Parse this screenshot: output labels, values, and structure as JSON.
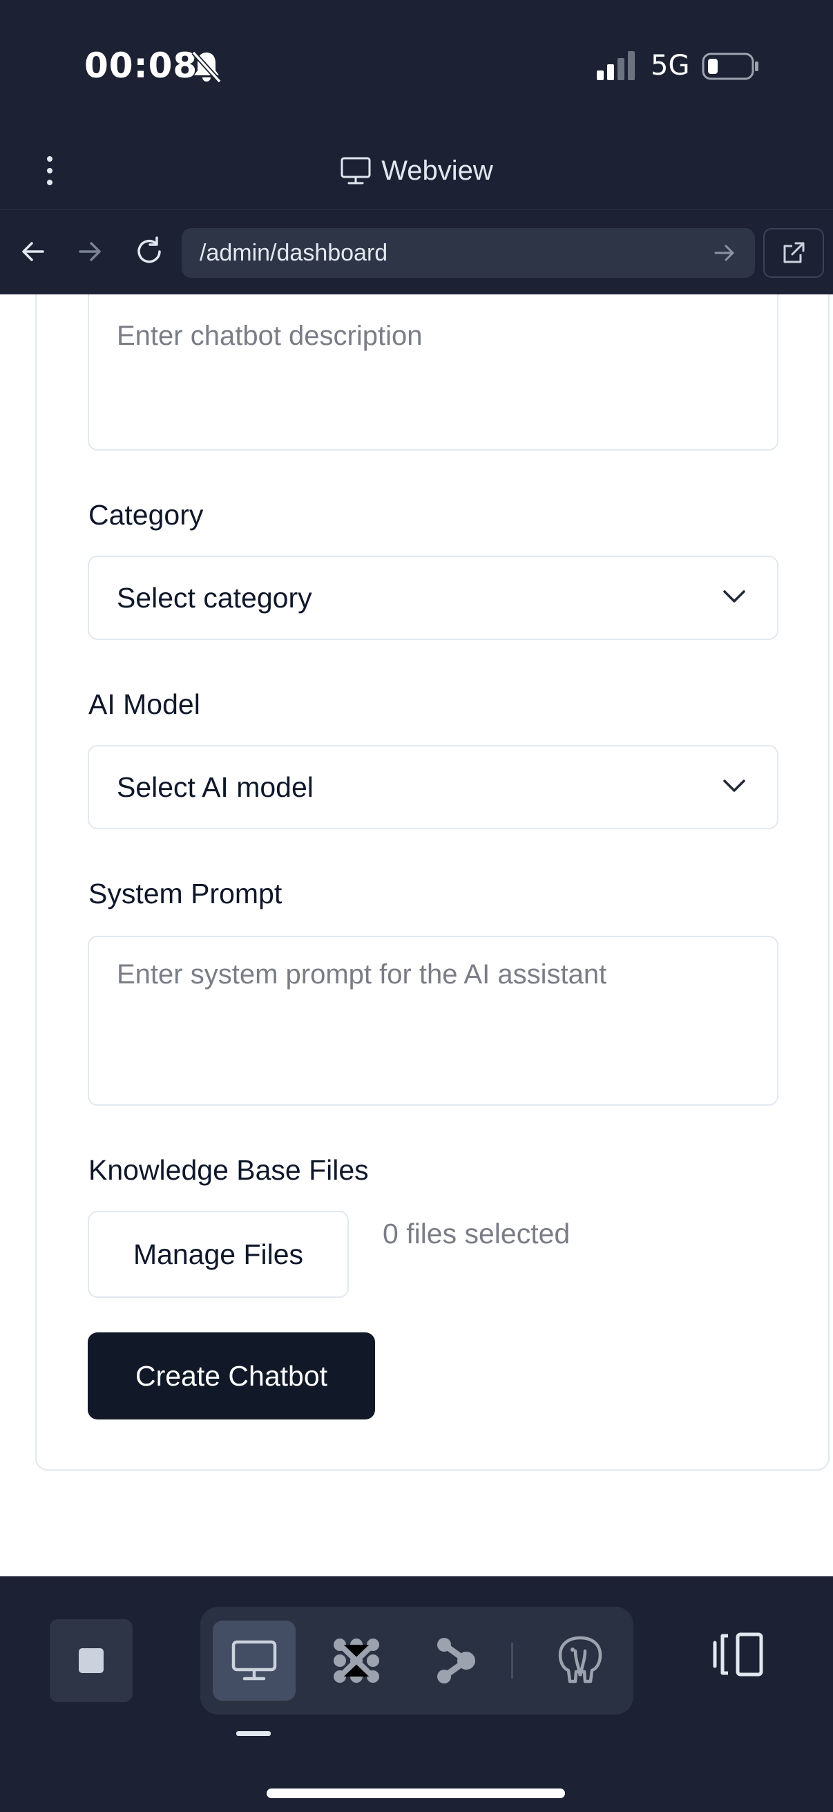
{
  "status_bar": {
    "time": "00:08",
    "network": "5G"
  },
  "header": {
    "title": "Webview",
    "url": "/admin/dashboard"
  },
  "form": {
    "description_placeholder": "Enter chatbot description",
    "category_label": "Category",
    "category_value": "Select category",
    "model_label": "AI Model",
    "model_value": "Select AI model",
    "prompt_label": "System Prompt",
    "prompt_placeholder": "Enter system prompt for the AI assistant",
    "files_label": "Knowledge Base Files",
    "manage_files": "Manage Files",
    "files_count": "0 files selected",
    "create": "Create Chatbot"
  },
  "colors": {
    "chrome_bg": "#1c2233",
    "primary_button": "#111827",
    "border": "#e2e8f0",
    "placeholder": "#7a7d86"
  },
  "icons": {
    "status": [
      "bell-slash-icon",
      "signal-icon",
      "battery-icon"
    ],
    "nav": [
      "kebab-menu-icon",
      "monitor-icon",
      "back-arrow-icon",
      "forward-arrow-icon",
      "reload-icon",
      "go-arrow-icon",
      "external-link-icon"
    ],
    "dock": [
      "stop-icon",
      "monitor-icon",
      "cluster-icon",
      "share-nodes-icon",
      "database-elephant-icon",
      "panel-toggle-icon"
    ]
  }
}
